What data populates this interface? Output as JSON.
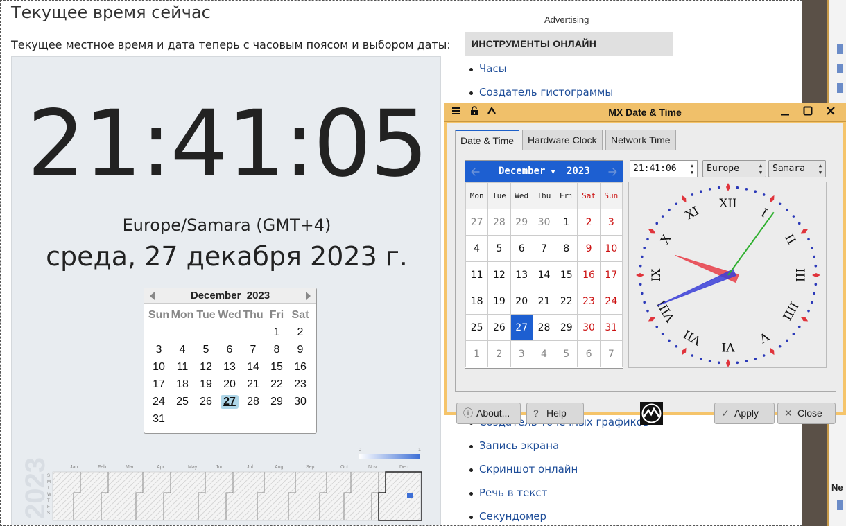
{
  "webpage": {
    "title": "Текущее время сейчас",
    "subtitle": "Текущее местное время и дата теперь с часовым поясом и выбором даты:",
    "time": "21:41:05",
    "timezone": "Europe/Samara (GMT+4)",
    "date": "среда, 27 декабря 2023 г.",
    "mini_calendar": {
      "month": "December",
      "year": "2023",
      "weekdays": [
        "Sun",
        "Mon",
        "Tue",
        "Wed",
        "Thu",
        "Fri",
        "Sat"
      ],
      "weeks": [
        [
          "",
          "",
          "",
          "",
          "",
          "1",
          "2"
        ],
        [
          "3",
          "4",
          "5",
          "6",
          "7",
          "8",
          "9"
        ],
        [
          "10",
          "11",
          "12",
          "13",
          "14",
          "15",
          "16"
        ],
        [
          "17",
          "18",
          "19",
          "20",
          "21",
          "22",
          "23"
        ],
        [
          "24",
          "25",
          "26",
          "27",
          "28",
          "29",
          "30"
        ],
        [
          "31",
          "",
          "",
          "",
          "",
          "",
          ""
        ]
      ],
      "today": "27"
    },
    "heatmap": {
      "year": "2023",
      "months": [
        "Jan",
        "Feb",
        "Mar",
        "Apr",
        "May",
        "Jun",
        "Jul",
        "Aug",
        "Sep",
        "Oct",
        "Nov",
        "Dec"
      ],
      "day_initials": [
        "S",
        "M",
        "T",
        "W",
        "T",
        "F",
        "S"
      ],
      "scale_min": "0",
      "scale_max": "1",
      "accent": "#3d6fd6"
    },
    "advertising": "Advertising",
    "tools_heading": "ИНСТРУМЕНТЫ ОНЛАЙН",
    "tools_links_top": [
      "Часы",
      "Создатель гистограммы"
    ],
    "tools_links_bottom": [
      "Создатель точечных графиков",
      "Запись экрана",
      "Скриншот онлайн",
      "Речь в текст",
      "Секундомер"
    ]
  },
  "background_window": {
    "partial_label": "Ne"
  },
  "mx_window": {
    "title": "MX Date & Time",
    "titlebar_icons": [
      "menu-icon",
      "lock-icon",
      "caret-up-icon",
      "minimize-icon",
      "maximize-icon",
      "close-icon"
    ],
    "tabs": [
      "Date & Time",
      "Hardware Clock",
      "Network Time"
    ],
    "active_tab": "Date & Time",
    "calendar": {
      "month": "December",
      "year": "2023",
      "weekdays": [
        "Mon",
        "Tue",
        "Wed",
        "Thu",
        "Fri",
        "Sat",
        "Sun"
      ],
      "weeks": [
        [
          "27",
          "28",
          "29",
          "30",
          "1",
          "2",
          "3"
        ],
        [
          "4",
          "5",
          "6",
          "7",
          "8",
          "9",
          "10"
        ],
        [
          "11",
          "12",
          "13",
          "14",
          "15",
          "16",
          "17"
        ],
        [
          "18",
          "19",
          "20",
          "21",
          "22",
          "23",
          "24"
        ],
        [
          "25",
          "26",
          "27",
          "28",
          "29",
          "30",
          "31"
        ],
        [
          "1",
          "2",
          "3",
          "4",
          "5",
          "6",
          "7"
        ]
      ],
      "selected": "27",
      "accent": "#1d5fd1"
    },
    "time_value": "21:41:06",
    "region": "Europe",
    "city": "Samara",
    "clock": {
      "numerals": [
        "XII",
        "I",
        "II",
        "III",
        "IIII",
        "V",
        "VI",
        "VII",
        "VIII",
        "IX",
        "X",
        "XI"
      ],
      "hour": 21,
      "minute": 41,
      "second": 6,
      "hour_hand_color": "#e8404a",
      "minute_hand_color": "#3b3fd8",
      "second_hand_color": "#2fb02f"
    },
    "buttons": {
      "about": "About...",
      "help": "Help",
      "apply": "Apply",
      "close": "Close"
    }
  }
}
